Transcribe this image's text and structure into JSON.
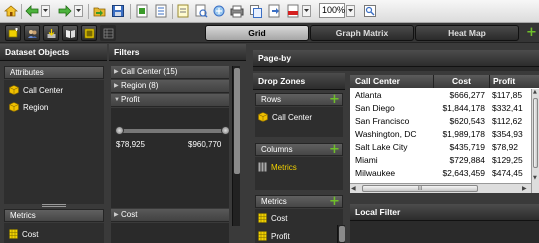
{
  "toolbar": {
    "zoom_value": "100%",
    "icons": [
      "home-icon",
      "back-icon",
      "forward-icon",
      "open-folder-icon",
      "save-icon",
      "export-icon",
      "page-icon",
      "notes-icon",
      "print-preview-icon",
      "share-icon",
      "print-icon",
      "copy-icon",
      "export-file-icon",
      "pdf-icon",
      "zoom-dropdown",
      "find-icon"
    ]
  },
  "views": {
    "tabs": [
      "Grid",
      "Graph Matrix",
      "Heat Map"
    ],
    "active_tab": "Grid"
  },
  "dataset_objects": {
    "title": "Dataset Objects",
    "attributes_header": "Attributes",
    "attributes": [
      "Call Center",
      "Region"
    ],
    "metrics_header": "Metrics",
    "metrics": [
      "Cost"
    ]
  },
  "filters": {
    "title": "Filters",
    "items": [
      "Call Center (15)",
      "Region (8)"
    ],
    "expanded": {
      "name": "Profit",
      "min_label": "$78,925",
      "max_label": "$960,770"
    },
    "bottom_item": "Cost"
  },
  "page_by": {
    "title": "Page-by"
  },
  "drop_zones": {
    "title": "Drop Zones",
    "rows_header": "Rows",
    "rows": [
      "Call Center"
    ],
    "columns_header": "Columns",
    "columns": [
      "Metrics"
    ],
    "metrics_header": "Metrics",
    "metrics": [
      "Cost",
      "Profit"
    ]
  },
  "grid": {
    "headers": [
      "Call Center",
      "Cost",
      "Profit"
    ],
    "rows": [
      {
        "city": "Atlanta",
        "cost": "$666,277",
        "profit": "$117,85"
      },
      {
        "city": "San Diego",
        "cost": "$1,844,178",
        "profit": "$332,41"
      },
      {
        "city": "San Francisco",
        "cost": "$620,543",
        "profit": "$112,62"
      },
      {
        "city": "Washington, DC",
        "cost": "$1,989,178",
        "profit": "$354,93"
      },
      {
        "city": "Salt Lake City",
        "cost": "$435,719",
        "profit": "$78,92"
      },
      {
        "city": "Miami",
        "cost": "$729,884",
        "profit": "$129,25"
      },
      {
        "city": "Milwaukee",
        "cost": "$2,643,459",
        "profit": "$474,45"
      }
    ],
    "hscroll_label": "III"
  },
  "local_filter": {
    "title": "Local Filter"
  },
  "colors": {
    "accent_green": "#6fbf2a",
    "metric_yellow": "#f0d000",
    "panel_dark": "#2e2e2e"
  }
}
